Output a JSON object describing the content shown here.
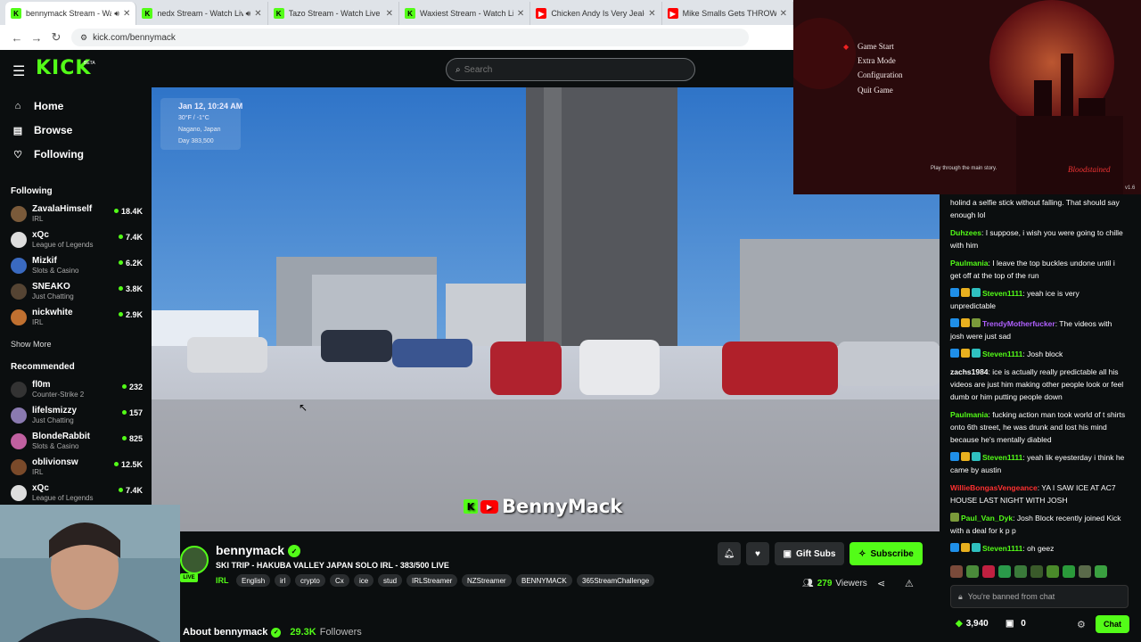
{
  "browser": {
    "tabs": [
      {
        "title": "bennymack Stream - Wat",
        "favicon": "kick",
        "active": true,
        "audio": true
      },
      {
        "title": "nedx Stream - Watch Live",
        "favicon": "kick",
        "audio": true
      },
      {
        "title": "Tazo Stream - Watch Live on",
        "favicon": "kick"
      },
      {
        "title": "Waxiest Stream - Watch Live",
        "favicon": "kick"
      },
      {
        "title": "Chicken Andy Is Very Jealous",
        "favicon": "youtube"
      },
      {
        "title": "Mike Smalls Gets THROWN O",
        "favicon": "youtube"
      }
    ],
    "url": "kick.com/bennymack"
  },
  "header": {
    "logo": "KICK",
    "logo_badge": "BETA",
    "search_placeholder": "Search"
  },
  "sidebar": {
    "nav": [
      {
        "label": "Home",
        "icon": "home-icon"
      },
      {
        "label": "Browse",
        "icon": "browse-icon"
      },
      {
        "label": "Following",
        "icon": "heart-icon"
      }
    ],
    "following_heading": "Following",
    "following": [
      {
        "name": "ZavalaHimself",
        "category": "IRL",
        "viewers": "18.4K",
        "color": "#7a5a3a"
      },
      {
        "name": "xQc",
        "category": "League of Legends",
        "viewers": "7.4K",
        "color": "#dddddd"
      },
      {
        "name": "Mizkif",
        "category": "Slots & Casino",
        "viewers": "6.2K",
        "color": "#3a6ac0"
      },
      {
        "name": "SNEAKO",
        "category": "Just Chatting",
        "viewers": "3.8K",
        "color": "#554433"
      },
      {
        "name": "nickwhite",
        "category": "IRL",
        "viewers": "2.9K",
        "color": "#c07030"
      }
    ],
    "show_more": "Show More",
    "recommended_heading": "Recommended",
    "recommended": [
      {
        "name": "fl0m",
        "category": "Counter-Strike 2",
        "viewers": "232",
        "color": "#333333"
      },
      {
        "name": "lifelsmizzy",
        "category": "Just Chatting",
        "viewers": "157",
        "color": "#8a7ab0"
      },
      {
        "name": "BlondeRabbit",
        "category": "Slots & Casino",
        "viewers": "825",
        "color": "#c060a0"
      },
      {
        "name": "oblivionsw",
        "category": "IRL",
        "viewers": "12.5K",
        "color": "#7a4a2a"
      },
      {
        "name": "xQc",
        "category": "League of Legends",
        "viewers": "7.4K",
        "color": "#dddddd"
      }
    ]
  },
  "video": {
    "overlay": {
      "date": "Jan 12, 10:24 AM",
      "temp": "30°F / -1°C",
      "location": "Nagano, Japan",
      "day": "Day 383,500"
    },
    "watermark": "BennyMack"
  },
  "game": {
    "menu": [
      "Game Start",
      "Extra Mode",
      "Configuration",
      "Quit Game"
    ],
    "hint": "Play through the main story.",
    "logo": "Bloodstained",
    "version": "v1.6"
  },
  "chat": {
    "messages": [
      {
        "user": "",
        "text": "holind a selfie stick without falling. That should say enough lol",
        "color": "#ffffff",
        "badges": []
      },
      {
        "user": "Duhzees",
        "text": "I suppose, i wish you were going to chille with him",
        "color": "#53fc18",
        "badges": []
      },
      {
        "user": "Paulmania",
        "text": "I leave the top buckles undone until i get off at the top of the run",
        "color": "#53fc18",
        "badges": []
      },
      {
        "user": "Steven1111",
        "text": "yeah ice is very unpredictable",
        "color": "#53fc18",
        "badges": [
          "#1f8fe8",
          "#e8b01f",
          "#2fc0c0"
        ]
      },
      {
        "user": "TrendyMotherfucker",
        "text": "The videos with josh were just sad",
        "color": "#b060ff",
        "badges": [
          "#1f8fe8",
          "#e8b01f",
          "#7a9a3a"
        ]
      },
      {
        "user": "Steven1111",
        "text": "Josh block",
        "color": "#53fc18",
        "badges": [
          "#1f8fe8",
          "#e8b01f",
          "#2fc0c0"
        ]
      },
      {
        "user": "zachs1984",
        "text": "ice is actually really predictable all his videos are just him making other people look or feel dumb or him putting people down",
        "color": "#ffffff",
        "badges": []
      },
      {
        "user": "Paulmania",
        "text": "fucking action man took world of t shirts onto 6th street, he was drunk and lost his mind because he's mentally diabled",
        "color": "#53fc18",
        "badges": []
      },
      {
        "user": "Steven1111",
        "text": "yeah lik eyesterday i think he came by austin",
        "color": "#53fc18",
        "badges": [
          "#1f8fe8",
          "#e8b01f",
          "#2fc0c0"
        ]
      },
      {
        "user": "WillieBongasVengeance",
        "text": "YA I SAW ICE AT AC7 HOUSE LAST NIGHT WITH JOSH",
        "color": "#ff3030",
        "badges": []
      },
      {
        "user": "Paul_Van_Dyk",
        "text": "Josh Block recently joined Kick with a deal for k p p",
        "color": "#53fc18",
        "badges": [
          "#7a9a3a"
        ]
      },
      {
        "user": "Steven1111",
        "text": "oh geez",
        "color": "#53fc18",
        "badges": [
          "#1f8fe8",
          "#e8b01f",
          "#2fc0c0"
        ]
      }
    ],
    "banned_text": "You're banned from chat",
    "points": "3,940",
    "gifts": "0",
    "chat_button": "Chat"
  },
  "stream": {
    "name": "bennymack",
    "live_label": "LIVE",
    "title": "SKI TRIP - HAKUBA VALLEY JAPAN SOLO IRL - 383/500 LIVE",
    "category": "IRL",
    "tags": [
      "English",
      "irl",
      "crypto",
      "Cx",
      "ice",
      "stud",
      "IRLStreamer",
      "NZStreamer",
      "BENNYMACK",
      "365StreamChallenge"
    ],
    "gift_subs": "Gift Subs",
    "subscribe": "Subscribe",
    "viewers_count": "279",
    "viewers_label": "Viewers",
    "about_label": "About bennymack",
    "followers_count": "29.3K",
    "followers_label": "Followers"
  },
  "colors": {
    "accent": "#53fc18",
    "background": "#0b0e0f"
  }
}
